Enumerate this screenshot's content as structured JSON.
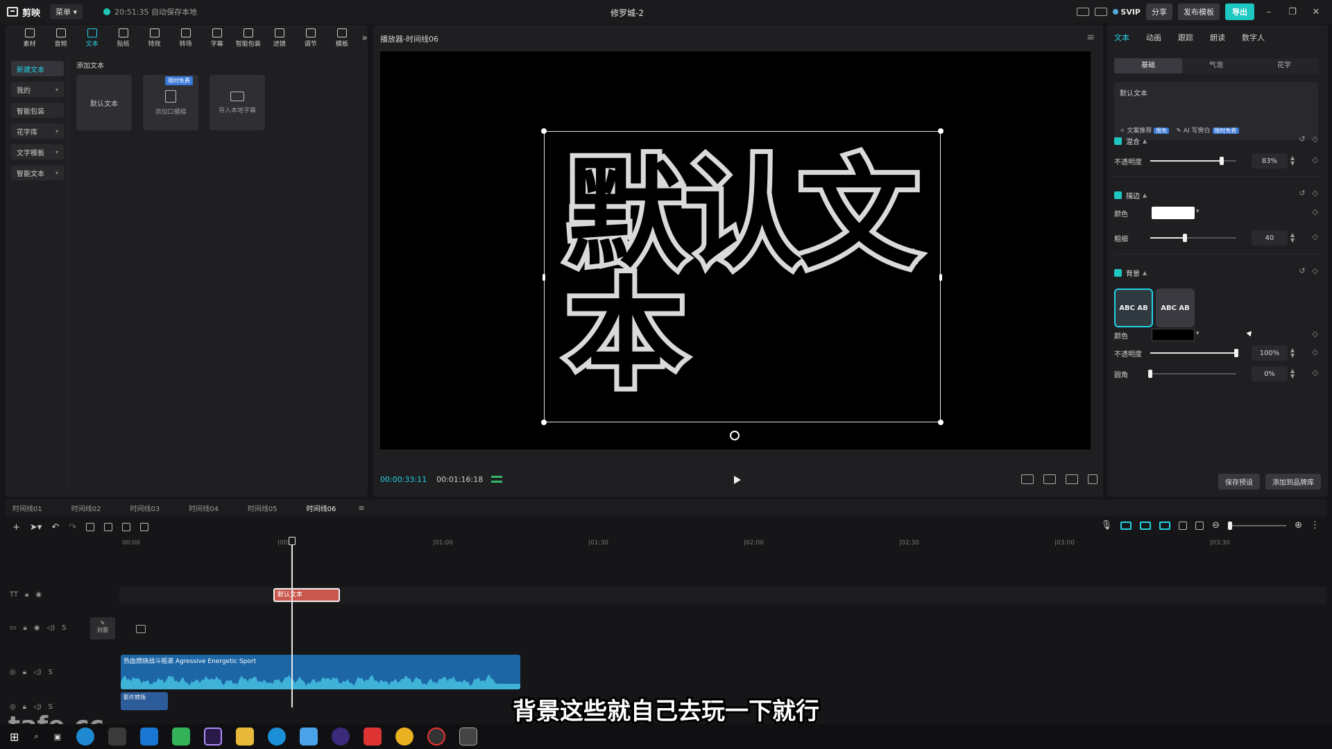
{
  "app": {
    "name": "剪映",
    "menu_label": "菜单",
    "autosave_text": "20:51:35 自动保存本地",
    "document_title": "修罗城-2",
    "svip_label": "SVIP",
    "share_label": "分享",
    "publish_label": "发布模板",
    "export_label": "导出"
  },
  "toolbar": {
    "items": [
      {
        "label": "素材",
        "icon": "media-icon"
      },
      {
        "label": "音频",
        "icon": "audio-icon"
      },
      {
        "label": "文本",
        "icon": "text-icon",
        "active": true
      },
      {
        "label": "贴纸",
        "icon": "sticker-icon"
      },
      {
        "label": "特效",
        "icon": "effects-icon"
      },
      {
        "label": "转场",
        "icon": "transition-icon"
      },
      {
        "label": "字幕",
        "icon": "caption-icon"
      },
      {
        "label": "智能包装",
        "icon": "smart-pack-icon"
      },
      {
        "label": "滤镜",
        "icon": "filter-icon"
      },
      {
        "label": "调节",
        "icon": "adjust-icon"
      },
      {
        "label": "模板",
        "icon": "template-icon"
      }
    ]
  },
  "sidebar": {
    "items": [
      {
        "label": "新建文本",
        "active": true,
        "has_chevron": false
      },
      {
        "label": "我的",
        "has_chevron": true
      },
      {
        "label": "智能包装",
        "has_chevron": false
      },
      {
        "label": "花字库",
        "has_chevron": true
      },
      {
        "label": "文字模板",
        "has_chevron": true
      },
      {
        "label": "智能文本",
        "has_chevron": true
      }
    ]
  },
  "add_text": {
    "section_label": "添加文本",
    "default_card": "默认文本",
    "caption_card": "添加口播稿",
    "caption_badge": "限时免费",
    "import_card": "导入本地字幕"
  },
  "player": {
    "title": "播放器-时间线06",
    "canvas_text_line1": "默认文",
    "canvas_text_line2": "本",
    "current_time": "00:00:33:11",
    "total_time": "00:01:16:18"
  },
  "inspector": {
    "tabs": [
      "文本",
      "动画",
      "跟踪",
      "朗读",
      "数字人"
    ],
    "subtabs": [
      "基础",
      "气泡",
      "花字"
    ],
    "text_content": "默认文本",
    "text_recommend": "文案推荐",
    "text_recommend_badge": "限免",
    "ai_write": "AI 写旁白",
    "ai_write_badge": "限时免费",
    "blend": {
      "title": "混合",
      "opacity_label": "不透明度",
      "opacity_value": "83%",
      "opacity_fraction": 0.83
    },
    "stroke": {
      "title": "描边",
      "color_label": "颜色",
      "color": "#ffffff",
      "thickness_label": "粗细",
      "thickness_value": "40",
      "thickness_fraction": 0.4
    },
    "background": {
      "title": "背景",
      "style_a": "ABC AB",
      "style_b": "ABC AB",
      "color_label": "颜色",
      "color": "#000000",
      "opacity_label": "不透明度",
      "opacity_value": "100%",
      "opacity_fraction": 1.0,
      "radius_label": "圆角",
      "radius_value": "0%",
      "radius_fraction": 0.0
    },
    "save_preset": "保存预设",
    "add_brand": "添加到品牌库"
  },
  "timeline": {
    "tabs": [
      "时间线01",
      "时间线02",
      "时间线03",
      "时间线04",
      "时间线05",
      "时间线06"
    ],
    "active_tab": 5,
    "ruler_ticks": [
      "00:00",
      "|00:3",
      "|01:00",
      "|01:30",
      "|02:00",
      "|02:30",
      "|03:00",
      "|03:30"
    ],
    "text_clip": "默认文本",
    "cover_label": "封面",
    "audio_clip": "热血燃烧战斗摇滚 Agressive Energetic Sport",
    "audio_clip2": "影片转场"
  },
  "subtitle": "背景这些就自己去玩一下就行",
  "watermark": "tafe.cc",
  "colors": {
    "accent": "#22d3e6",
    "text_clip": "#c9574d",
    "audio_clip": "#1d66a6"
  }
}
